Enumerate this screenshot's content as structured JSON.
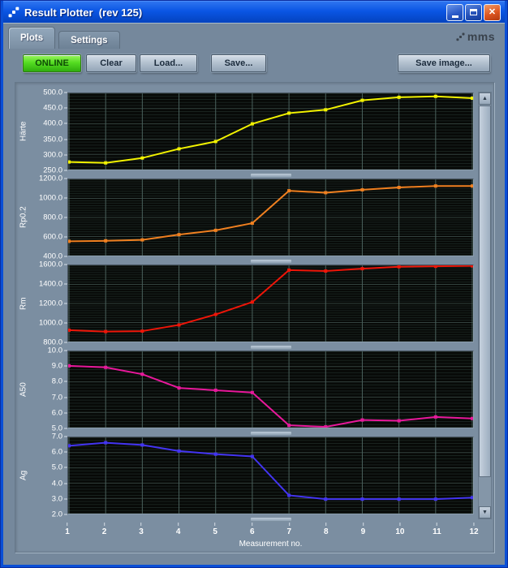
{
  "window": {
    "title": "Result Plotter  (rev 125)"
  },
  "tabs": [
    {
      "label": "Plots",
      "active": true
    },
    {
      "label": "Settings",
      "active": false
    }
  ],
  "logo": {
    "text": "mms"
  },
  "toolbar": {
    "online_label": "ONLINE",
    "clear_label": "Clear",
    "load_label": "Load...",
    "save_label": "Save...",
    "save_image_label": "Save image..."
  },
  "xaxis": {
    "label": "Measurement no.",
    "ticks": [
      "1",
      "2",
      "3",
      "4",
      "5",
      "6",
      "7",
      "8",
      "9",
      "10",
      "11",
      "12"
    ]
  },
  "colors": {
    "titlebar_blue": "#0a55e4",
    "panel_gray_blue": "#7b8ea1",
    "plot_background": "#070907",
    "grid_vertical": "#4a615c",
    "grid_major": "#33423e",
    "grid_minor": "#19231f",
    "online_green": "#55dd22"
  },
  "chart_data": [
    {
      "type": "line",
      "ylabel": "Härte",
      "color": "#f2f200",
      "ylim": [
        250,
        500
      ],
      "ytick_step": 50,
      "minor_per_major": 4,
      "x": [
        1,
        2,
        3,
        4,
        5,
        6,
        7,
        8,
        9,
        10,
        11,
        12
      ],
      "values": [
        275,
        272,
        288,
        318,
        342,
        400,
        435,
        446,
        477,
        487,
        490,
        484
      ]
    },
    {
      "type": "line",
      "ylabel": "Rp0.2",
      "color": "#f08020",
      "ylim": [
        400,
        1200
      ],
      "ytick_step": 200,
      "minor_per_major": 7,
      "x": [
        1,
        2,
        3,
        4,
        5,
        6,
        7,
        8,
        9,
        10,
        11,
        12
      ],
      "values": [
        550,
        555,
        565,
        620,
        665,
        740,
        1080,
        1060,
        1090,
        1115,
        1130,
        1130
      ]
    },
    {
      "type": "line",
      "ylabel": "Rm",
      "color": "#ee1508",
      "ylim": [
        800,
        1600
      ],
      "ytick_step": 200,
      "minor_per_major": 7,
      "x": [
        1,
        2,
        3,
        4,
        5,
        6,
        7,
        8,
        9,
        10,
        11,
        12
      ],
      "values": [
        920,
        905,
        910,
        975,
        1085,
        1215,
        1550,
        1540,
        1565,
        1585,
        1590,
        1595
      ]
    },
    {
      "type": "line",
      "ylabel": "A50",
      "color": "#e8189b",
      "ylim": [
        5,
        10
      ],
      "ytick_step": 1,
      "minor_per_major": 4,
      "x": [
        1,
        2,
        3,
        4,
        5,
        6,
        7,
        8,
        9,
        10,
        11,
        12
      ],
      "values": [
        9.05,
        8.95,
        8.5,
        7.6,
        7.45,
        7.3,
        5.15,
        5.05,
        5.5,
        5.45,
        5.7,
        5.6
      ]
    },
    {
      "type": "line",
      "ylabel": "Ag",
      "color": "#4334f2",
      "ylim": [
        2,
        7
      ],
      "ytick_step": 1,
      "minor_per_major": 4,
      "x": [
        1,
        2,
        3,
        4,
        5,
        6,
        7,
        8,
        9,
        10,
        11,
        12
      ],
      "values": [
        6.45,
        6.65,
        6.5,
        6.1,
        5.9,
        5.75,
        3.2,
        2.95,
        2.95,
        2.95,
        2.95,
        3.05
      ]
    }
  ]
}
